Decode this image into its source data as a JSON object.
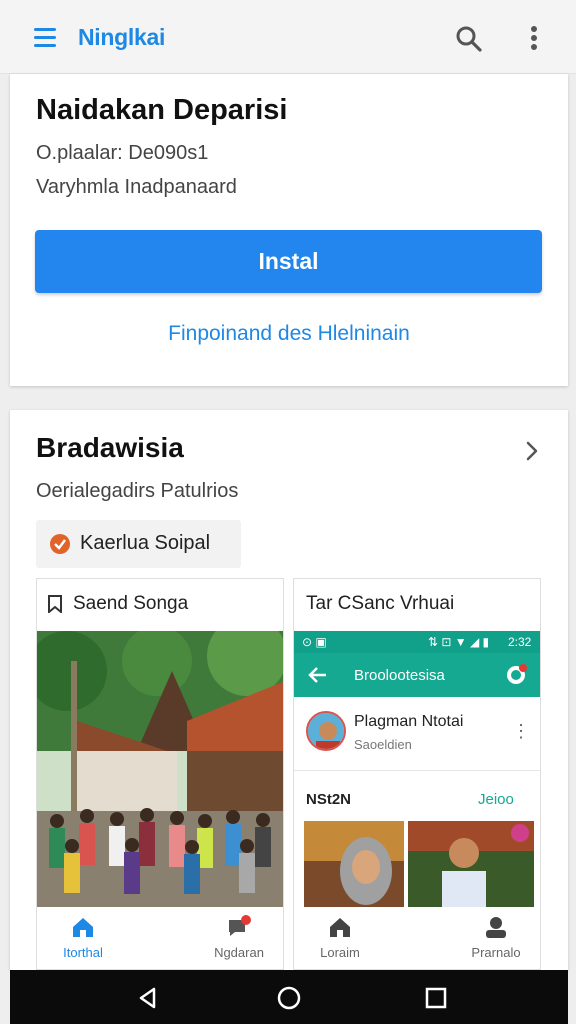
{
  "appbar": {
    "title": "Ninglkai",
    "menu_icon": "menu-icon",
    "search_icon": "search-icon",
    "more_icon": "more-vert-icon",
    "accent": "#1e88e5"
  },
  "app_card": {
    "name": "Naidakan Deparisi",
    "meta1": "O.plaalar: De090s1",
    "meta2": "Varyhmla Inadpanaard",
    "install_label": "Instal",
    "link_label": "Finpoinand des Hlelninain",
    "button_color": "#2286ee"
  },
  "section": {
    "title": "Bradawisia",
    "subtitle": "Oerialegadirs Patulrios",
    "chip_label": "Kaerlua Soipal",
    "chip_color": "#e0632a"
  },
  "screenshots": [
    {
      "caption": "Saend Songa",
      "caption_icon": "bookmark-icon",
      "nav": [
        {
          "label": "Itorthal",
          "icon": "home-icon"
        },
        {
          "label": "Ngdaran",
          "icon": "chat-notification-icon"
        }
      ]
    },
    {
      "caption": "Tar CSanc Vrhuai",
      "status_time": "2:32",
      "toolbar_title": "Broolootesisa",
      "profile_name": "Plagman Ntotai",
      "profile_sub": "Saoeldien",
      "row_left": "NSt2N",
      "row_right": "Jeioo",
      "nav": [
        {
          "label": "Loraim",
          "icon": "home-icon"
        },
        {
          "label": "Prarnalo",
          "icon": "person-icon"
        }
      ]
    }
  ],
  "system_nav": [
    "back-icon",
    "home-circle-icon",
    "recents-icon"
  ]
}
